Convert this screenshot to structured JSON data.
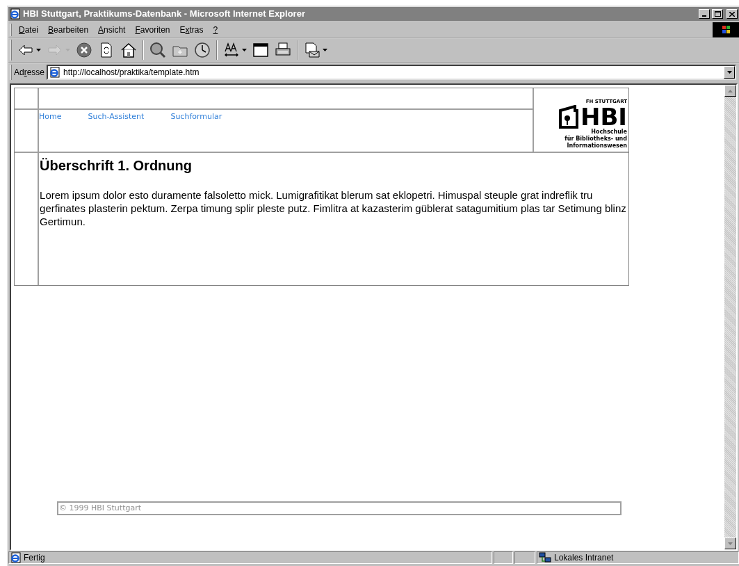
{
  "window": {
    "title": "HBI Stuttgart, Praktikums-Datenbank - Microsoft Internet Explorer"
  },
  "menu": [
    "Datei",
    "Bearbeiten",
    "Ansicht",
    "Favoriten",
    "Extras",
    "?"
  ],
  "toolbar": [
    {
      "kind": "back",
      "disabled": false,
      "dropdown": true
    },
    {
      "kind": "forward",
      "disabled": true,
      "dropdown": true
    },
    {
      "kind": "stop",
      "disabled": false,
      "dropdown": false
    },
    {
      "kind": "refresh",
      "disabled": false,
      "dropdown": false
    },
    {
      "kind": "home",
      "disabled": false,
      "dropdown": false
    },
    {
      "kind": "sep"
    },
    {
      "kind": "search",
      "disabled": false,
      "dropdown": false
    },
    {
      "kind": "favorites",
      "disabled": false,
      "dropdown": false
    },
    {
      "kind": "history",
      "disabled": false,
      "dropdown": false
    },
    {
      "kind": "sep"
    },
    {
      "kind": "font",
      "disabled": false,
      "dropdown": true
    },
    {
      "kind": "window",
      "disabled": false,
      "dropdown": false
    },
    {
      "kind": "print",
      "disabled": false,
      "dropdown": false
    },
    {
      "kind": "sep"
    },
    {
      "kind": "mail",
      "disabled": false,
      "dropdown": true
    }
  ],
  "address": {
    "label": "Adresse",
    "url": "http://localhost/praktika/template.htm"
  },
  "page": {
    "nav": [
      "Home",
      "Such-Assistent",
      "Suchformular"
    ],
    "logo": {
      "top": "FH STUTTGART",
      "mark": "HBI",
      "lines": [
        "Hochschule",
        "für Bibliotheks- und",
        "Informationswesen"
      ]
    },
    "heading": "Überschrift 1. Ordnung",
    "paragraph": "Lorem ipsum dolor esto duramente falsoletto mick. Lumigrafitikat blerum sat eklopetri. Himuspal steuple grat indreflik tru gerfinates plasterin pektum. Zerpa timung splir pleste putz. Fimlitra at kazasterim güblerat satagumitium plas tar Setimung blinz Gertimun.",
    "footer": "© 1999 HBI Stuttgart"
  },
  "status_bar": {
    "text": "Fertig",
    "zone": "Lokales Intranet"
  }
}
